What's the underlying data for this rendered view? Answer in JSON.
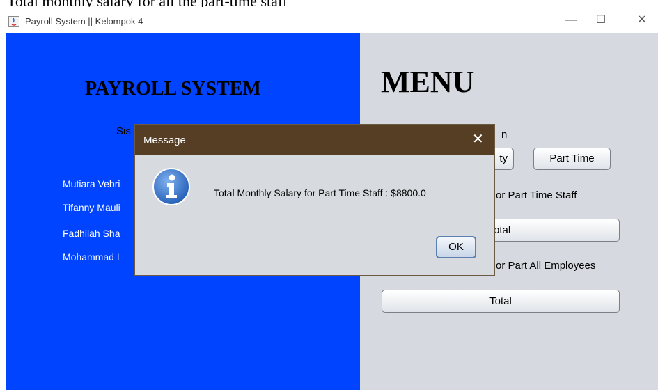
{
  "caption": "Total monthly salary for all the part-time staff",
  "window": {
    "title": "Payroll System || Kelompok 4",
    "minimize": "—",
    "maximize": "☐",
    "close": "✕"
  },
  "left_panel": {
    "title": "PAYROLL SYSTEM",
    "subtitle": "Sis",
    "members": [
      "Mutiara Vebri",
      "Tifanny Mauli",
      "Fadhilah Sha",
      "Mohammad I"
    ]
  },
  "right_panel": {
    "title": "MENU",
    "section_label_partial": "n",
    "faculty_button": "ty",
    "part_time_button": "Part Time",
    "part_time_total_label": "or Part Time Staff",
    "part_time_total_button": "otal",
    "all_employees_label": "or Part All Employees",
    "all_employees_total_button": "Total"
  },
  "dialog": {
    "title": "Message",
    "close": "✕",
    "message": "Total Monthly Salary for Part Time Staff : $8800.0",
    "ok": "OK",
    "icon": "info-icon"
  },
  "colors": {
    "left_panel": "#0044ff",
    "right_panel": "#d6d9df",
    "dialog_titlebar": "#563e24",
    "info_icon": "#2f6fc7"
  }
}
